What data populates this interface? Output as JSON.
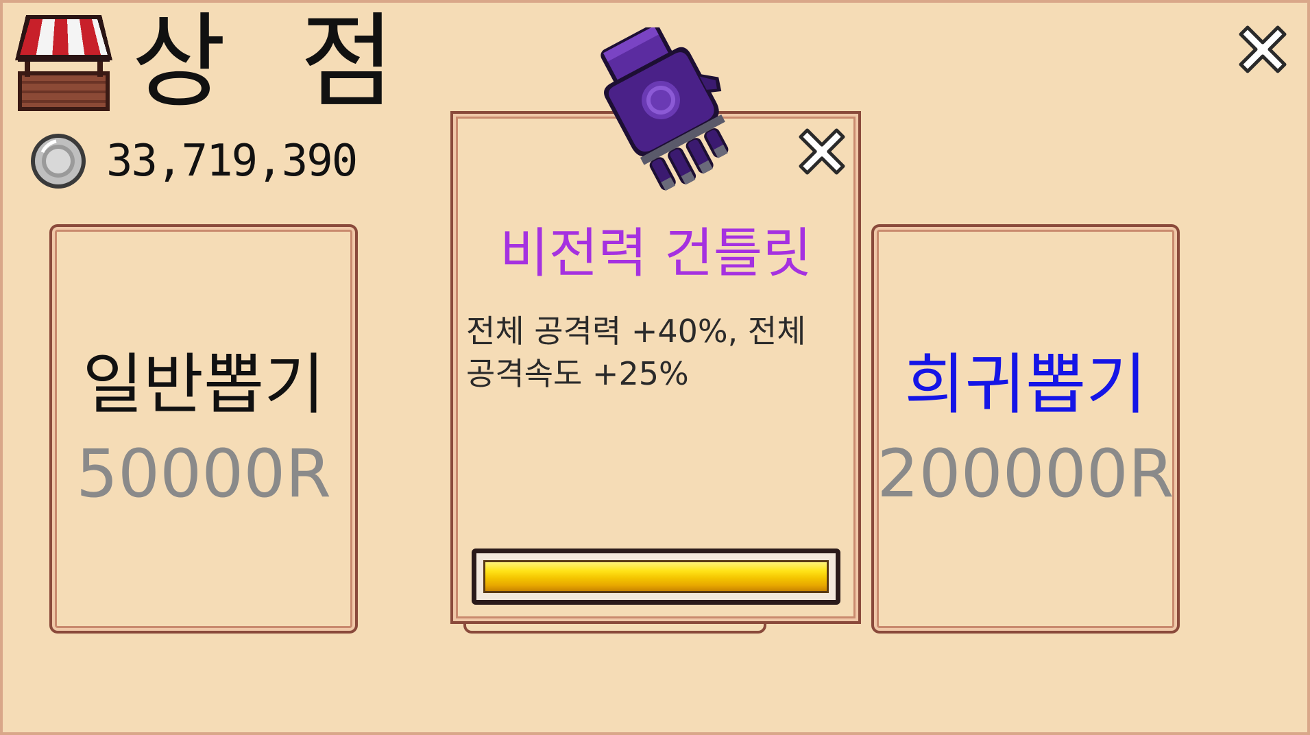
{
  "header": {
    "title": "상 점",
    "coins": "33,719,390"
  },
  "normal_gacha": {
    "label": "일반뽑기",
    "price": "50000R"
  },
  "rare_gacha": {
    "label": "희귀뽑기",
    "price": "200000R"
  },
  "item_popup": {
    "name": "비전력 건틀릿",
    "description": "전체 공격력 +40%, 전체 공격속도 +25%",
    "progress_fraction": 1.0
  },
  "colors": {
    "background": "#f5dcb6",
    "panel_border": "#8a4a3b",
    "item_name": "#a531e0",
    "rare_label": "#1515e6",
    "normal_label": "#111111",
    "price": "#8a8a8a",
    "progress_fill": "#ffd400"
  },
  "icons": {
    "shop": "shop-stall-icon",
    "coin": "coin-icon",
    "close": "close-icon",
    "item": "gauntlet-icon"
  }
}
